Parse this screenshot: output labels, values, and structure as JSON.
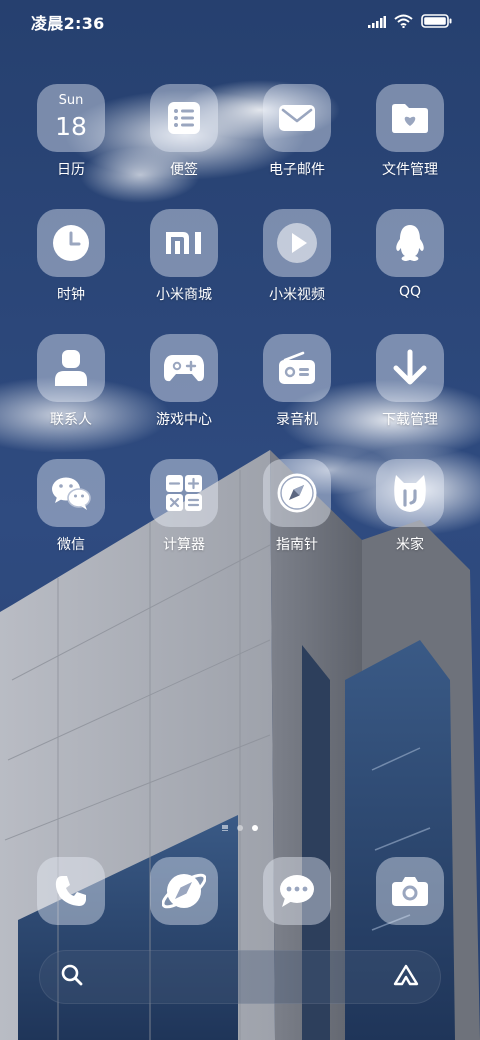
{
  "status_bar": {
    "time": "凌晨2:36",
    "icons": [
      "signal-icon",
      "wifi-icon",
      "battery-icon"
    ]
  },
  "apps": [
    {
      "label": "日历",
      "icon": "calendar-icon",
      "day": "Sun",
      "date": "18"
    },
    {
      "label": "便签",
      "icon": "notes-icon"
    },
    {
      "label": "电子邮件",
      "icon": "mail-icon"
    },
    {
      "label": "文件管理",
      "icon": "folder-icon"
    },
    {
      "label": "时钟",
      "icon": "clock-icon"
    },
    {
      "label": "小米商城",
      "icon": "mi-logo-icon"
    },
    {
      "label": "小米视频",
      "icon": "play-icon"
    },
    {
      "label": "QQ",
      "icon": "qq-penguin-icon"
    },
    {
      "label": "联系人",
      "icon": "contact-person-icon"
    },
    {
      "label": "游戏中心",
      "icon": "gamepad-icon"
    },
    {
      "label": "录音机",
      "icon": "radio-recorder-icon"
    },
    {
      "label": "下载管理",
      "icon": "download-arrow-icon"
    },
    {
      "label": "微信",
      "icon": "wechat-icon"
    },
    {
      "label": "计算器",
      "icon": "calculator-icon"
    },
    {
      "label": "指南针",
      "icon": "compass-icon"
    },
    {
      "label": "米家",
      "icon": "mijia-icon"
    }
  ],
  "page_indicator": {
    "pages": 2,
    "active": 2
  },
  "dock": [
    {
      "icon": "phone-icon"
    },
    {
      "icon": "browser-icon"
    },
    {
      "icon": "messages-icon"
    },
    {
      "icon": "camera-icon"
    }
  ],
  "search_bar": {
    "left_icon": "search-icon",
    "right_icon": "assistant-icon"
  },
  "colors": {
    "sky": "#2a4477",
    "icon_bg": "rgba(235,240,250,0.42)",
    "glyph": "#ffffff"
  }
}
